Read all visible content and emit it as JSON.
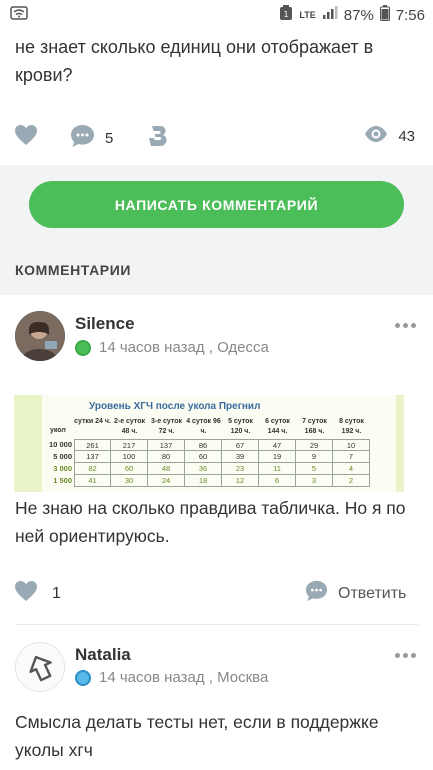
{
  "status_bar": {
    "network": "LTE",
    "battery": "87%",
    "time": "7:56",
    "icons": [
      "wifi-icon",
      "notification-icon",
      "lte-icon",
      "signal-icon",
      "battery-icon"
    ]
  },
  "question": {
    "text": "не знает сколько единиц они отображает в крови?"
  },
  "stats": {
    "comments_count": "5",
    "views_count": "43"
  },
  "actions": {
    "write_comment_label": "НАПИСАТЬ КОММЕНТАРИЙ"
  },
  "comments_section": {
    "heading": "КОММЕНТАРИИ"
  },
  "comments": [
    {
      "author": "Silence",
      "time_location": "14 часов назад , Одесса",
      "status_color": "#4cbe59",
      "text": "Не знаю на сколько правдива табличка. Но я по ней ориентируюсь.",
      "likes": "1",
      "reply_label": "Ответить",
      "table": {
        "title": "Уровень ХГЧ после укола Прегнил",
        "ukol_label": "укол",
        "columns": [
          "сутки 24 ч.",
          "2-е суток 48 ч.",
          "3-е суток 72 ч.",
          "4 суток 96 ч.",
          "5 суток 120 ч.",
          "6 суток 144 ч.",
          "7 суток 168 ч.",
          "8 суток 192 ч."
        ],
        "rows": [
          {
            "dose": "10 000",
            "values": [
              "261",
              "217",
              "137",
              "86",
              "67",
              "47",
              "29",
              "10"
            ]
          },
          {
            "dose": "5 000",
            "values": [
              "137",
              "100",
              "80",
              "60",
              "39",
              "19",
              "9",
              "7"
            ]
          },
          {
            "dose": "3 000",
            "values": [
              "82",
              "60",
              "48",
              "36",
              "23",
              "11",
              "5",
              "4"
            ]
          },
          {
            "dose": "1 500",
            "values": [
              "41",
              "30",
              "24",
              "18",
              "12",
              "6",
              "3",
              "2"
            ]
          }
        ]
      }
    },
    {
      "author": "Natalia",
      "time_location": "14 часов назад , Москва",
      "status_color": "#5ab8e6",
      "text": "Смысла делать тесты нет, если в поддержке уколы хгч"
    }
  ],
  "colors": {
    "accent_green": "#4cbe59",
    "grey_bg": "#f2f3f5",
    "icon_grey": "#9aaab4"
  }
}
